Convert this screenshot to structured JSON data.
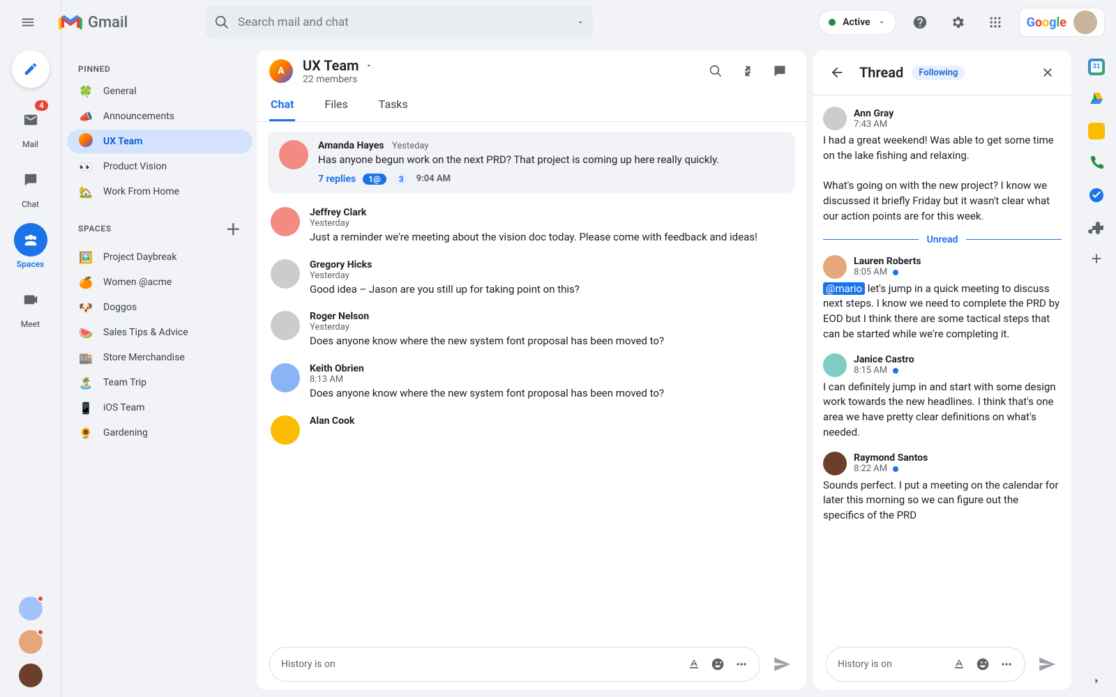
{
  "brand": {
    "name": "Gmail"
  },
  "search": {
    "placeholder": "Search mail and chat"
  },
  "status": {
    "label": "Active"
  },
  "google_word": [
    "G",
    "o",
    "o",
    "g",
    "l",
    "e"
  ],
  "rail": {
    "items": [
      {
        "label": "Mail",
        "badge": "4"
      },
      {
        "label": "Chat"
      },
      {
        "label": "Spaces"
      },
      {
        "label": "Meet"
      }
    ]
  },
  "sidebar": {
    "pinned_title": "PINNED",
    "spaces_title": "SPACES",
    "pinned": [
      {
        "icon": "🍀",
        "label": "General"
      },
      {
        "icon": "📣",
        "label": "Announcements"
      },
      {
        "icon": "A",
        "label": "UX Team",
        "active": true,
        "avatar": true
      },
      {
        "icon": "👀",
        "label": "Product Vision"
      },
      {
        "icon": "🏡",
        "label": "Work From Home"
      }
    ],
    "spaces": [
      {
        "icon": "🖼️",
        "label": "Project Daybreak"
      },
      {
        "icon": "🍊",
        "label": "Women @acme"
      },
      {
        "icon": "🐶",
        "label": "Doggos"
      },
      {
        "icon": "🍉",
        "label": "Sales Tips & Advice"
      },
      {
        "icon": "🏬",
        "label": "Store Merchandise"
      },
      {
        "icon": "🏝️",
        "label": "Team Trip"
      },
      {
        "icon": "📱",
        "label": "iOS Team"
      },
      {
        "icon": "🌻",
        "label": "Gardening"
      }
    ]
  },
  "space": {
    "name": "UX Team",
    "members": "22 members",
    "tabs": [
      "Chat",
      "Files",
      "Tasks"
    ]
  },
  "highlight": {
    "author": "Amanda Hayes",
    "timestamp": "Yesteday",
    "body": "Has anyone begun work on the next PRD? That project is coming up here really quickly.",
    "replies_label": "7 replies",
    "badge_mentions": "1@",
    "badge_count": "3",
    "replies_time": "9:04 AM"
  },
  "messages": [
    {
      "author": "Jeffrey Clark",
      "timestamp": "Yesterday",
      "body": "Just a reminder we're meeting about the vision doc today. Please come with feedback and ideas!",
      "c": "c1"
    },
    {
      "author": "Gregory Hicks",
      "timestamp": "Yesterday",
      "body": "Good idea – Jason are you still up for taking point on this?",
      "c": "c3"
    },
    {
      "author": "Roger Nelson",
      "timestamp": "Yesterday",
      "body": "Does anyone know where the new system font proposal has been moved to?",
      "c": "c3"
    },
    {
      "author": "Keith Obrien",
      "timestamp": "8:13 AM",
      "body": "Does anyone know where the new system font proposal has been moved to?",
      "c": "c7"
    },
    {
      "author": "Alan Cook",
      "timestamp": "",
      "body": "",
      "c": "c2"
    }
  ],
  "composer": {
    "hint": "History is on"
  },
  "thread": {
    "title": "Thread",
    "chip": "Following",
    "unread_label": "Unread",
    "items": [
      {
        "author": "Ann Gray",
        "time": "7:43 AM",
        "dot": false,
        "c": "c3",
        "body": "I had a great weekend! Was able to get some time on the lake fishing and relaxing.\n\nWhat's going on with the new project? I know we discussed it briefly Friday but it wasn't clear what our action points are for this week."
      },
      {
        "author": "Lauren Roberts",
        "time": "8:05 AM",
        "dot": true,
        "mention": "@mario",
        "c": "c9",
        "body": "let's jump in a quick meeting to discuss next steps. I know we need to complete the PRD by EOD but I think there are some tactical steps that can be started while we're completing it."
      },
      {
        "author": "Janice Castro",
        "time": "8:15 AM",
        "dot": true,
        "c": "c6",
        "body": "I can definitely jump in and start with some design work towards the new headlines. I think that's one area we have pretty clear definitions on what's needed."
      },
      {
        "author": "Raymond Santos",
        "time": "8:22 AM",
        "dot": true,
        "c": "c10",
        "body": "Sounds perfect. I put a meeting on the calendar for later this morning so we can figure out the specifics of the PRD"
      }
    ]
  }
}
